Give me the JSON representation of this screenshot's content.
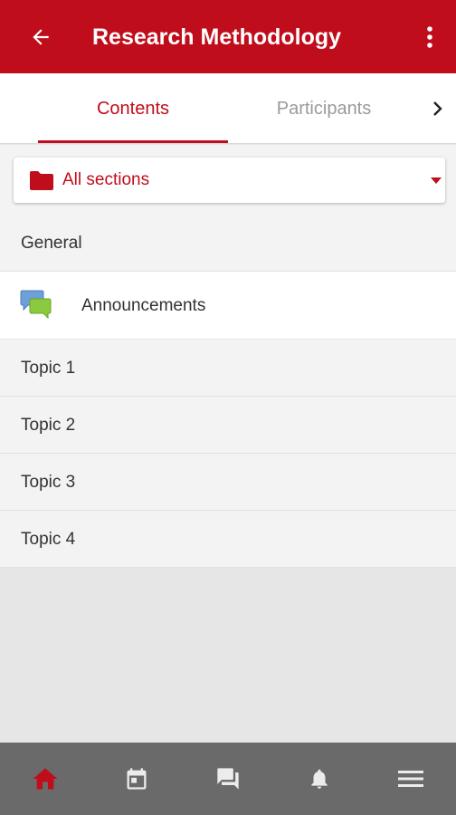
{
  "header": {
    "title": "Research Methodology",
    "back_icon": "arrow-left-icon",
    "menu_icon": "more-vertical-icon"
  },
  "tabs": [
    {
      "label": "Contents",
      "active": true
    },
    {
      "label": "Participants",
      "active": false
    }
  ],
  "tabs_next_icon": "chevron-right-icon",
  "section_filter": {
    "selected": "All sections",
    "icon": "folder-icon",
    "caret_icon": "caret-down-icon"
  },
  "sections": [
    {
      "name": "General",
      "modules": [
        {
          "label": "Announcements",
          "icon": "forum-icon"
        }
      ]
    },
    {
      "name": "Topic 1",
      "modules": []
    },
    {
      "name": "Topic 2",
      "modules": []
    },
    {
      "name": "Topic 3",
      "modules": []
    },
    {
      "name": "Topic 4",
      "modules": []
    }
  ],
  "bottom_nav": [
    {
      "name": "home-icon",
      "active": true
    },
    {
      "name": "calendar-icon",
      "active": false
    },
    {
      "name": "messages-icon",
      "active": false
    },
    {
      "name": "notifications-icon",
      "active": false
    },
    {
      "name": "more-menu-icon",
      "active": false
    }
  ],
  "colors": {
    "brand": "#c00d1b",
    "inactive_tab": "#9a9a9a",
    "nav_bar": "#6a6a6a",
    "nav_icon": "#ececec"
  }
}
